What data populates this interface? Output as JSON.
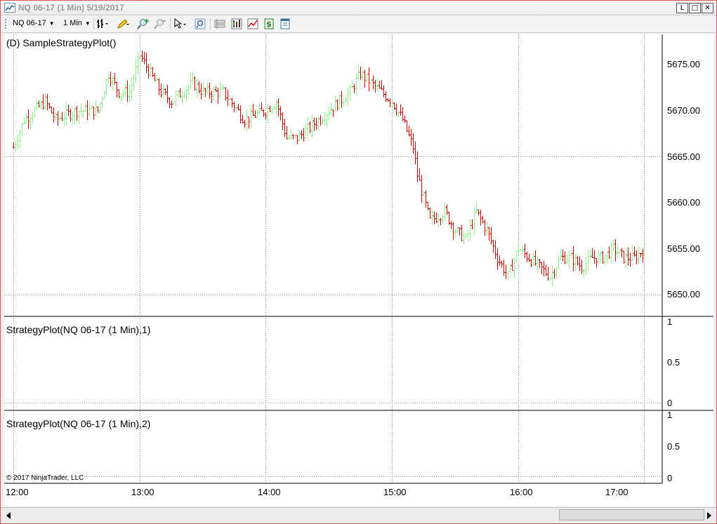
{
  "window": {
    "title": "NQ 06-17 (1 Min)  5/19/2017",
    "controls": [
      "minimize",
      "restore",
      "close"
    ]
  },
  "toolbar": {
    "instrument": "NQ 06-17",
    "interval": "1 Min",
    "icons": [
      "bar-type-icon",
      "pencil-draw-icon",
      "zoom-in-icon",
      "zoom-out-icon",
      "cursor-pointer-icon",
      "magnifier-icon",
      "properties-icon",
      "indicators-icon",
      "strategies-icon",
      "dollar-performance-icon",
      "data-box-icon"
    ]
  },
  "colors": {
    "up": "#90ee90",
    "down": "#c00000",
    "grid": "#9a9a9a"
  },
  "panels": {
    "price": {
      "label": "(D) SampleStrategyPlot()",
      "ticks": [
        "5675.00",
        "5670.00",
        "5665.00",
        "5660.00",
        "5655.00",
        "5650.00"
      ]
    },
    "plot1": {
      "label": "StrategyPlot(NQ 06-17 (1 Min),1)",
      "ticks": [
        "1",
        "0.5",
        "0"
      ]
    },
    "plot2": {
      "label": "StrategyPlot(NQ 06-17 (1 Min),2)",
      "ticks": [
        "1",
        "0.5",
        "0"
      ]
    }
  },
  "x_axis": {
    "ticks": [
      "12:00",
      "13:00",
      "14:00",
      "15:00",
      "16:00",
      "17:00"
    ]
  },
  "copyright": "© 2017 NinjaTrader, LLC",
  "chart_data": {
    "type": "bar",
    "title": "",
    "xlabel": "",
    "ylabel": "",
    "ylim": [
      5648,
      5677
    ],
    "x_range": [
      "12:00",
      "17:00"
    ],
    "grid": true,
    "series_description": "",
    "waypoints": [
      [
        "12:00",
        5666
      ],
      [
        "12:05",
        5669
      ],
      [
        "12:10",
        5670
      ],
      [
        "12:15",
        5671
      ],
      [
        "12:20",
        5669
      ],
      [
        "12:30",
        5670
      ],
      [
        "12:40",
        5670
      ],
      [
        "12:45",
        5674
      ],
      [
        "12:50",
        5672
      ],
      [
        "12:55",
        5672
      ],
      [
        "13:00",
        5676
      ],
      [
        "13:05",
        5674
      ],
      [
        "13:10",
        5672
      ],
      [
        "13:15",
        5671
      ],
      [
        "13:25",
        5673
      ],
      [
        "13:30",
        5672
      ],
      [
        "13:40",
        5672
      ],
      [
        "13:50",
        5669
      ],
      [
        "14:00",
        5670
      ],
      [
        "14:05",
        5671
      ],
      [
        "14:10",
        5667
      ],
      [
        "14:15",
        5667
      ],
      [
        "14:20",
        5668
      ],
      [
        "14:30",
        5670
      ],
      [
        "14:40",
        5672
      ],
      [
        "14:45",
        5674
      ],
      [
        "14:50",
        5673
      ],
      [
        "14:55",
        5672
      ],
      [
        "15:00",
        5671
      ],
      [
        "15:05",
        5669
      ],
      [
        "15:10",
        5666
      ],
      [
        "15:12",
        5663
      ],
      [
        "15:18",
        5658
      ],
      [
        "15:25",
        5659
      ],
      [
        "15:30",
        5657
      ],
      [
        "15:35",
        5656
      ],
      [
        "15:40",
        5659
      ],
      [
        "15:45",
        5657
      ],
      [
        "15:50",
        5654
      ],
      [
        "15:55",
        5652
      ],
      [
        "16:00",
        5655
      ],
      [
        "16:05",
        5654
      ],
      [
        "16:10",
        5653
      ],
      [
        "16:15",
        5652
      ],
      [
        "16:20",
        5654
      ],
      [
        "16:25",
        5654
      ],
      [
        "16:30",
        5653
      ],
      [
        "16:35",
        5654
      ],
      [
        "16:40",
        5654
      ],
      [
        "16:45",
        5655
      ],
      [
        "16:50",
        5654
      ],
      [
        "16:55",
        5654
      ],
      [
        "17:00",
        5655
      ]
    ]
  }
}
